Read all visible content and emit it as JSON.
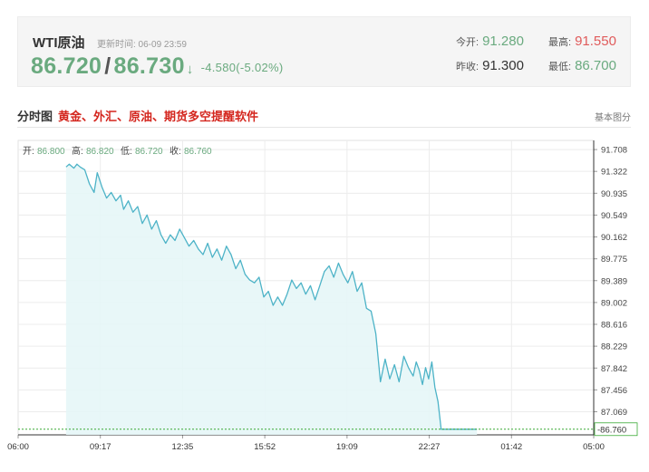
{
  "quote": {
    "name": "WTI原油",
    "updated": "更新时间: 06-09 23:59",
    "bid": "86.720",
    "separator": "/",
    "ask": "86.730",
    "arrow": "↓",
    "change": "-4.580(-5.02%)",
    "open_label": "今开:",
    "open_value": "91.280",
    "high_label": "最高:",
    "high_value": "91.550",
    "prev_close_label": "昨收:",
    "prev_close_value": "91.300",
    "low_label": "最低:",
    "low_value": "86.700"
  },
  "section": {
    "title": "分时图",
    "link": "黄金、外汇、原油、期货多空提醒软件",
    "right": "基本图分"
  },
  "colors": {
    "up_green": "#6aaa7f",
    "high_red": "#e05b5b",
    "line": "#4db3c7",
    "area": "#e6f6f7",
    "title_red": "#d4261e"
  },
  "chart_data": {
    "type": "area",
    "ohlc": [
      {
        "label": "开:",
        "value": "86.800"
      },
      {
        "label": "高:",
        "value": "86.820"
      },
      {
        "label": "低:",
        "value": "86.720"
      },
      {
        "label": "收:",
        "value": "86.760"
      }
    ],
    "x_ticks": [
      "06:00",
      "09:17",
      "12:35",
      "15:52",
      "19:09",
      "22:27",
      "01:42",
      "05:00"
    ],
    "y_ticks": [
      "91.708",
      "91.322",
      "90.935",
      "90.549",
      "90.162",
      "89.775",
      "89.389",
      "89.002",
      "88.616",
      "88.229",
      "87.842",
      "87.456",
      "87.069"
    ],
    "ylim": [
      86.66,
      91.87
    ],
    "current_price": "86.760",
    "grid": true,
    "series": [
      {
        "x_minutes": [
          115,
          125,
          140,
          150,
          160,
          175,
          190,
          205,
          215,
          230,
          245,
          260,
          275,
          290,
          300,
          315,
          330,
          345,
          360,
          375,
          390,
          405,
          420,
          435,
          450,
          465,
          480,
          495,
          510,
          525,
          540,
          555,
          570,
          585,
          600,
          615,
          630,
          645,
          660,
          675,
          690,
          705,
          720,
          735,
          750,
          765,
          780,
          795,
          810,
          825,
          840,
          855,
          870,
          885,
          900,
          915,
          930,
          945,
          960,
          975,
          990,
          1005,
          1020,
          1035,
          1050,
          1065,
          1080,
          1095,
          1110,
          1125,
          1140,
          1155,
          1170,
          1185,
          1200,
          1215,
          1230,
          1240,
          1250,
          1260,
          1270,
          1280,
          1290,
          1300,
          1310,
          1320,
          1330,
          1340,
          1350,
          1360,
          1370,
          1380,
          1390,
          1400,
          1410,
          1420,
          1428,
          1435
        ],
        "values": [
          91.4,
          91.45,
          91.38,
          91.45,
          91.4,
          91.35,
          91.1,
          90.95,
          91.3,
          91.05,
          90.85,
          90.95,
          90.8,
          90.9,
          90.65,
          90.8,
          90.6,
          90.7,
          90.4,
          90.55,
          90.3,
          90.45,
          90.2,
          90.05,
          90.2,
          90.1,
          90.3,
          90.15,
          90.0,
          90.1,
          89.95,
          89.85,
          90.05,
          89.8,
          89.95,
          89.75,
          90.0,
          89.85,
          89.6,
          89.75,
          89.5,
          89.4,
          89.35,
          89.45,
          89.1,
          89.2,
          88.95,
          89.1,
          88.95,
          89.15,
          89.4,
          89.25,
          89.35,
          89.15,
          89.3,
          89.05,
          89.3,
          89.55,
          89.65,
          89.45,
          89.7,
          89.5,
          89.35,
          89.55,
          89.2,
          89.35,
          88.9,
          88.85,
          88.45,
          87.6,
          88.0,
          87.65,
          87.9,
          87.6,
          88.05,
          87.85,
          87.7,
          87.95,
          87.8,
          87.55,
          87.85,
          87.65,
          87.95,
          87.5,
          87.25,
          86.76,
          86.76,
          86.76,
          86.76,
          86.76,
          86.76,
          86.76,
          86.76,
          86.76,
          86.76,
          86.76,
          86.76,
          86.76
        ],
        "end_minute": 1100
      }
    ]
  }
}
